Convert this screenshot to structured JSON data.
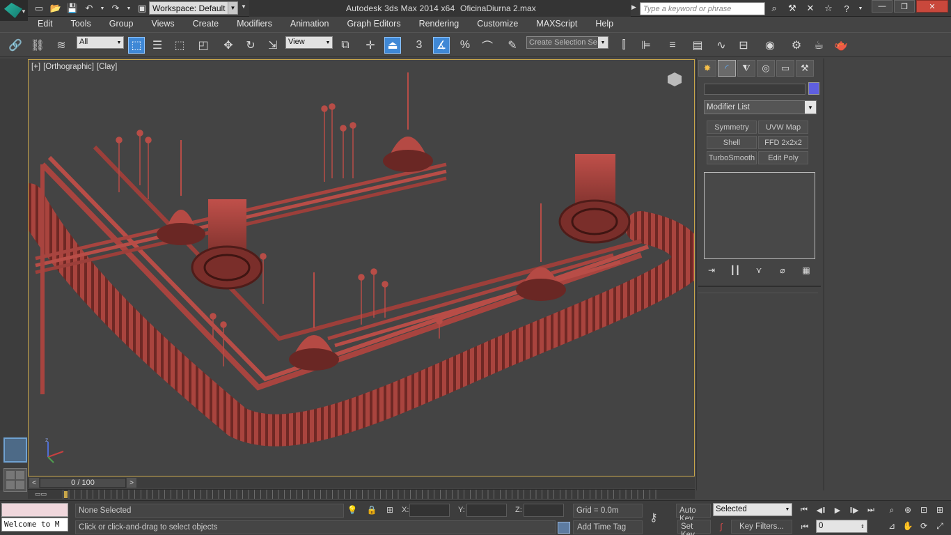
{
  "titlebar": {
    "workspace": "Workspace: Default",
    "app_title": "Autodesk 3ds Max  2014 x64",
    "file_name": "OficinaDiurna 2.max",
    "search_placeholder": "Type a keyword or phrase"
  },
  "menu": [
    "Edit",
    "Tools",
    "Group",
    "Views",
    "Create",
    "Modifiers",
    "Animation",
    "Graph Editors",
    "Rendering",
    "Customize",
    "MAXScript",
    "Help"
  ],
  "toolbar": {
    "filter_value": "All",
    "ref_coord_value": "View",
    "snap_label": "3",
    "angle_snap_label": "%",
    "selection_set_placeholder": "Create Selection Se"
  },
  "viewport": {
    "label_plus": "[+]",
    "label_view": "[Orthographic]",
    "label_shading": "[Clay]",
    "object_color": "#b04a44"
  },
  "command_panel": {
    "modifier_list": "Modifier List",
    "object_color": "#5f5fe0",
    "modifier_buttons": [
      "Symmetry",
      "UVW Map",
      "Shell",
      "FFD 2x2x2",
      "TurboSmooth",
      "Edit Poly"
    ]
  },
  "timeline": {
    "time_slider": "0 / 100"
  },
  "status": {
    "listener_text": "Welcome to M",
    "selection": "None Selected",
    "x_label": "X:",
    "y_label": "Y:",
    "z_label": "Z:",
    "grid": "Grid = 0.0m",
    "prompt": "Click or click-and-drag to select objects",
    "add_time_tag": "Add Time Tag",
    "auto_key": "Auto Key",
    "set_key": "Set Key",
    "key_mode_select": "Selected",
    "key_filters": "Key Filters...",
    "current_frame": "0"
  }
}
